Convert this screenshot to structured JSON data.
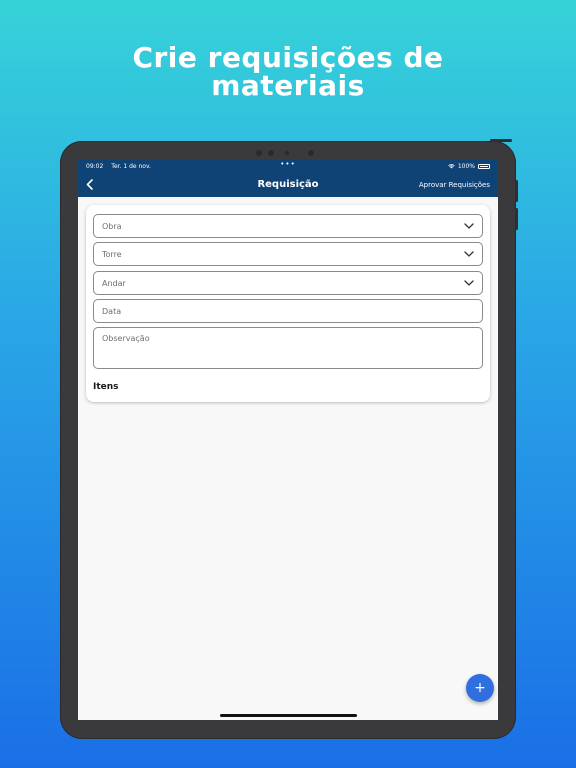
{
  "promo": {
    "headline_line1": "Crie requisições de",
    "headline_line2": "materiais"
  },
  "status_bar": {
    "time": "09:02",
    "date": "Ter. 1 de nov.",
    "dots": "•••",
    "battery": "100%"
  },
  "nav": {
    "title": "Requisição",
    "action": "Aprovar Requisições",
    "back_icon": "chevron-left-icon"
  },
  "form": {
    "obra_placeholder": "Obra",
    "torre_placeholder": "Torre",
    "andar_placeholder": "Andar",
    "data_placeholder": "Data",
    "observacao_placeholder": "Observação",
    "itens_label": "Itens"
  },
  "fab": {
    "label": "+",
    "icon": "plus-icon"
  },
  "colors": {
    "navbar": "#0f4376",
    "fab": "#2f6fdf",
    "background_top": "#36d3d8",
    "background_bottom": "#1a6fe6"
  }
}
